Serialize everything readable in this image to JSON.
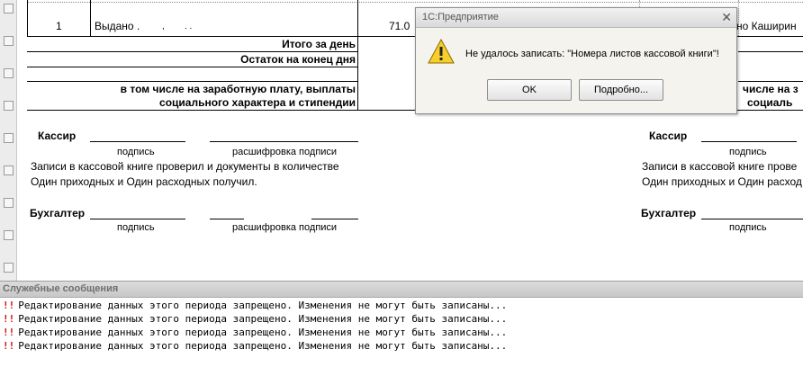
{
  "report": {
    "row1": {
      "num": "1",
      "text": "Выдано .",
      "dots": ",        . .",
      "amount": "71.0",
      "right_text": "но Каширин"
    },
    "itogo": "Итого за день",
    "ostatok": "Остаток на конец  дня",
    "v_tom_line1": "в том числе на заработную плату, выплаты",
    "v_tom_line2": "социального характера и стипендии",
    "v_tom_right1": "числе на з",
    "v_tom_right2": "социаль",
    "kassir": "Кассир",
    "podpis": "подпись",
    "rasshifrovka": "расшифровка подписи",
    "zapisi_line1": "Записи в кассовой книге проверил и документы в количестве",
    "zapisi_line2": "Один приходных и Один расходных получил.",
    "zapisi_right1": "Записи в кассовой книге прове",
    "zapisi_right2": "Один приходных и Один расход",
    "buhgalter": "Бухгалтер"
  },
  "dialog": {
    "title": "1С:Предприятие",
    "message": "Не удалось записать: \"Номера листов кассовой книги\"!",
    "ok_label": "OK",
    "details_label": "Подробно...",
    "close_glyph": "✕",
    "icon": "warning-icon"
  },
  "messages": {
    "header": "Служебные сообщения",
    "marker": "!!",
    "items": [
      "Редактирование данных этого периода запрещено. Изменения не могут быть записаны...",
      "Редактирование данных этого периода запрещено. Изменения не могут быть записаны...",
      "Редактирование данных этого периода запрещено. Изменения не могут быть записаны...",
      "Редактирование данных этого периода запрещено. Изменения не могут быть записаны..."
    ]
  },
  "colors": {
    "error_marker": "#d01010",
    "warning_fill": "#f6cf2a"
  }
}
